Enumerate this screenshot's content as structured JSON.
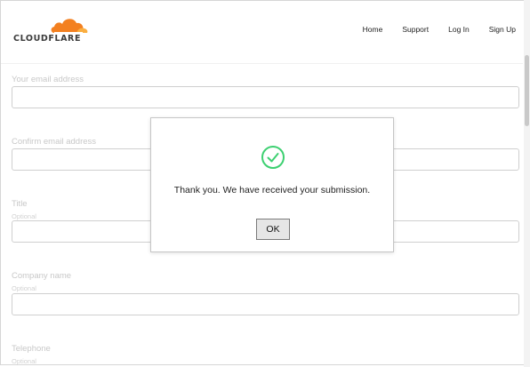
{
  "brand": {
    "name": "CLOUDFLARE",
    "accent": "#f38020",
    "accent_light": "#faae40"
  },
  "nav": {
    "items": [
      "Home",
      "Support",
      "Log In",
      "Sign Up"
    ]
  },
  "form": {
    "fields": [
      {
        "label": "Your email address",
        "sub": "",
        "value": ""
      },
      {
        "label": "Confirm email address",
        "sub": "",
        "value": ""
      },
      {
        "label": "Title",
        "sub": "Optional",
        "value": ""
      },
      {
        "label": "Company name",
        "sub": "Optional",
        "value": ""
      },
      {
        "label": "Telephone",
        "sub": "Optional",
        "value": ""
      }
    ]
  },
  "dialog": {
    "icon": "check-circle-icon",
    "success_color": "#3dd071",
    "message": "Thank you. We have received your submission.",
    "ok_label": "OK"
  }
}
